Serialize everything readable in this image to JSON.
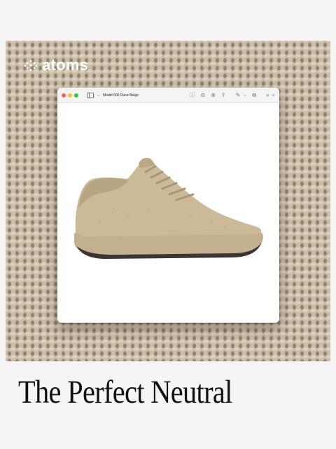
{
  "brand": {
    "name": "atoms",
    "icon": "sparkle-dots-icon",
    "color": "#ffffff"
  },
  "window": {
    "title": "Model 000 Dune Beige",
    "controls": [
      "close-dot",
      "minimize-dot",
      "zoom-dot"
    ],
    "toolbar_icons": [
      "sidebar-icon",
      "chevron-down-icon",
      "info-icon",
      "zoom-out-icon",
      "zoom-in-icon",
      "share-icon",
      "pen-icon",
      "chevron-down-icon",
      "rotate-icon",
      "more-icon",
      "search-icon"
    ]
  },
  "product": {
    "image": "shoe-image",
    "color": "#c7b696"
  },
  "headline": "The Perfect Neutral",
  "colors": {
    "background": "#c9bda6",
    "page": "#f5f5f5",
    "text": "#111111"
  }
}
